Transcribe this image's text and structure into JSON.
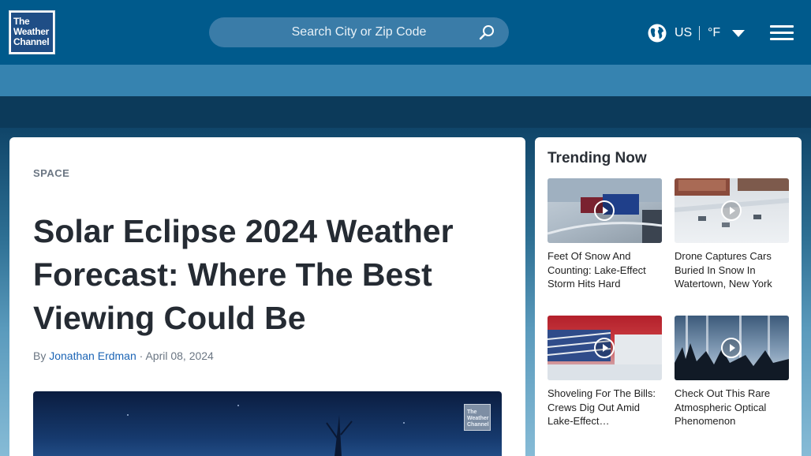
{
  "header": {
    "logo_lines": [
      "The",
      "Weather",
      "Channel"
    ],
    "search_placeholder": "Search City or Zip Code",
    "country": "US",
    "unit": "°F"
  },
  "article": {
    "category": "SPACE",
    "headline": "Solar Eclipse 2024 Weather Forecast: Where The Best Viewing Could Be",
    "by_prefix": "By",
    "author": "Jonathan Erdman",
    "separator": "·",
    "date": "April 08, 2024",
    "video_badge": [
      "The",
      "Weather",
      "Channel"
    ]
  },
  "trending": {
    "title": "Trending Now",
    "items": [
      {
        "title": "Feet Of Snow And Counting: Lake-Effect Storm Hits Hard"
      },
      {
        "title": "Drone Captures Cars Buried In Snow In Watertown, New York"
      },
      {
        "title": "Shoveling For The Bills: Crews Dig Out Amid Lake-Effect…"
      },
      {
        "title": "Check Out This Rare Atmospheric Optical Phenomenon"
      }
    ]
  }
}
